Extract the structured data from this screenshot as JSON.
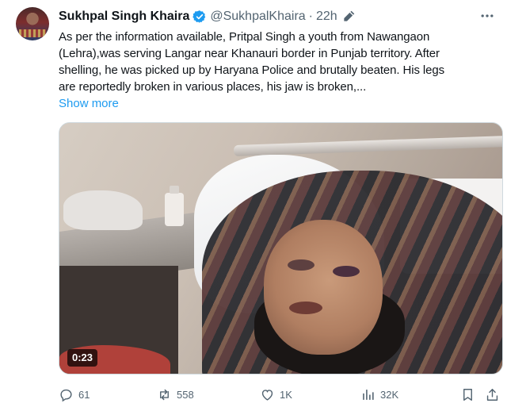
{
  "tweet": {
    "author_name": "Sukhpal Singh Khaira",
    "handle": "@SukhpalKhaira",
    "separator": "·",
    "time": "22h",
    "text_lines": [
      "As per the information available, Pritpal Singh a youth from Nawangaon",
      "(Lehra),was serving Langar near Khanauri border in Punjab territory. After",
      "shelling, he was picked up by Haryana Police and brutally beaten. His legs",
      "are reportedly broken in various places, his jaw is broken,..."
    ],
    "show_more": "Show more",
    "video_duration": "0:23",
    "actions": {
      "replies": "61",
      "reposts": "558",
      "likes": "1K",
      "views": "32K"
    }
  },
  "colors": {
    "link": "#1d9bf0",
    "verified": "#1d9bf0",
    "secondary_text": "#536471"
  },
  "icons": [
    "verified-badge-icon",
    "edit-icon",
    "more-icon",
    "reply-icon",
    "repost-icon",
    "like-icon",
    "views-icon",
    "bookmark-icon",
    "share-icon"
  ]
}
